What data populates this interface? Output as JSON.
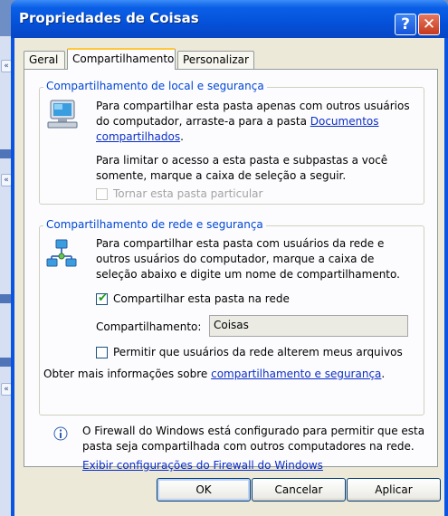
{
  "window": {
    "title": "Propriedades de Coisas",
    "help_glyph": "?",
    "close_glyph": "✕"
  },
  "tabs": [
    {
      "label": "Geral"
    },
    {
      "label": "Compartilhamento"
    },
    {
      "label": "Personalizar"
    }
  ],
  "local_group": {
    "legend": "Compartilhamento de local e segurança",
    "para1_a": "Para compartilhar esta pasta apenas com outros usuários",
    "para1_b": "do computador, arraste-a para a pasta ",
    "para1_link1": "Documentos",
    "para1_link2": "compartilhados",
    "para1_end": ".",
    "para2_a": "Para limitar o acesso a esta pasta e subpastas a você",
    "para2_b": "somente, marque a caixa de seleção a seguir.",
    "private_checkbox_label": "Tornar esta pasta particular",
    "private_checked": false,
    "private_disabled": true
  },
  "network_group": {
    "legend": "Compartilhamento de rede e segurança",
    "para_a": "Para compartilhar esta pasta com usuários da rede e",
    "para_b": "outros usuários do computador, marque a caixa de",
    "para_c": "seleção abaixo e digite um nome de compartilhamento.",
    "share_checkbox_label": "Compartilhar esta pasta na rede",
    "share_checked": true,
    "share_name_label": "Compartilhamento:",
    "share_name_value": "Coisas",
    "allow_change_label": "Permitir que usuários da rede alterem meus arquivos",
    "allow_change_checked": false,
    "more_info_text": "Obter mais informações sobre ",
    "more_info_link": "compartilhamento e segurança",
    "more_info_end": "."
  },
  "firewall": {
    "info_glyph": "i",
    "line1": "O Firewall do Windows está configurado para permitir que esta",
    "line2": "pasta seja compartilhada com outros computadores na rede.",
    "link": "Exibir configurações do Firewall do Windows"
  },
  "buttons": {
    "ok": "OK",
    "cancel": "Cancelar",
    "apply": "Aplicar"
  },
  "background": {
    "collapse_glyph": "«"
  },
  "colors": {
    "titlebar": "#0a54e3",
    "legend_text": "#0046d5",
    "link": "#0b2ec7",
    "checkmark": "#21a121"
  }
}
